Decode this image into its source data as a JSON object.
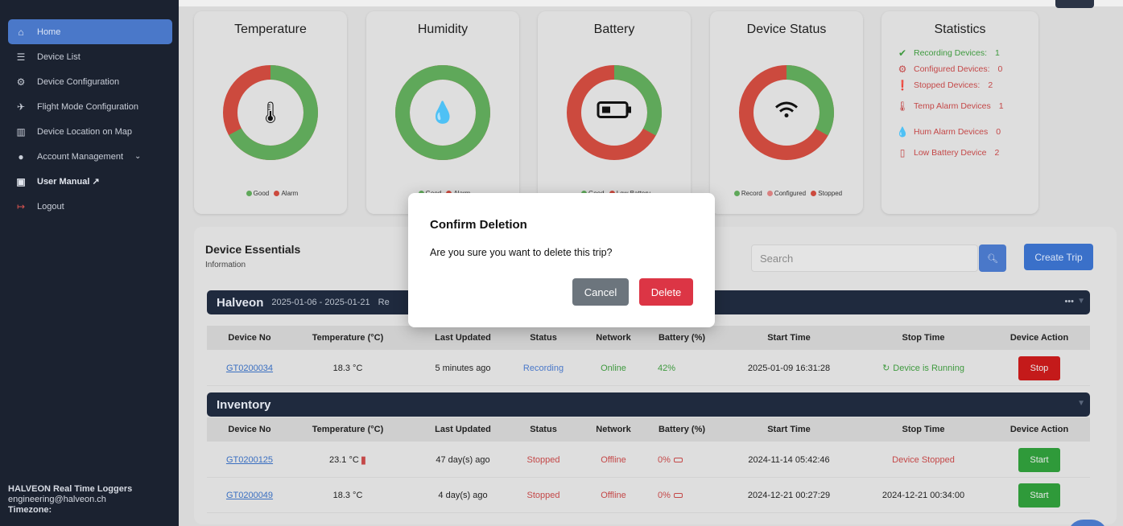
{
  "sidebar": {
    "items": [
      {
        "label": "Home",
        "icon": "home-icon"
      },
      {
        "label": "Device List",
        "icon": "list-icon"
      },
      {
        "label": "Device Configuration",
        "icon": "gear-icon"
      },
      {
        "label": "Flight Mode Configuration",
        "icon": "plane-icon"
      },
      {
        "label": "Device Location on Map",
        "icon": "map-icon"
      },
      {
        "label": "Account Management",
        "icon": "user-icon"
      },
      {
        "label": "User Manual ↗",
        "icon": "manual-icon"
      },
      {
        "label": "Logout",
        "icon": "logout-icon"
      }
    ],
    "footer": {
      "company": "HALVEON Real Time Loggers",
      "email": "engineering@halveon.ch",
      "timezone": "Timezone:"
    }
  },
  "cards": {
    "temperature": {
      "title": "Temperature",
      "legend_good": "Good",
      "legend_alarm": "Alarm",
      "good_fraction": 0.67
    },
    "humidity": {
      "title": "Humidity",
      "legend_good": "Good",
      "legend_alarm": "Alarm",
      "good_fraction": 1.0
    },
    "battery": {
      "title": "Battery",
      "legend_good": "Good",
      "legend_low": "Low Battery",
      "good_fraction": 0.33
    },
    "device_status": {
      "title": "Device Status",
      "legend_record": "Record",
      "legend_configured": "Configured",
      "legend_stopped": "Stopped",
      "record_fraction": 0.33
    },
    "statistics": {
      "title": "Statistics",
      "items": [
        {
          "label": "Recording Devices:",
          "value": "1",
          "color": "#3f9a3f"
        },
        {
          "label": "Configured Devices:",
          "value": "0",
          "color": "#c44848"
        },
        {
          "label": "Stopped Devices:",
          "value": "2",
          "color": "#c44848"
        },
        {
          "label": "Temp Alarm Devices",
          "value": "1",
          "color": "#c44848"
        },
        {
          "label": "Hum Alarm Devices",
          "value": "0",
          "color": "#c44848"
        },
        {
          "label": "Low Battery Device",
          "value": "2",
          "color": "#c44848"
        }
      ]
    }
  },
  "essentials": {
    "title": "Device Essentials",
    "subtitle": "Information",
    "search_placeholder": "Search",
    "create_label": "Create Trip",
    "headers": [
      "Device No",
      "Temperature (°C)",
      "Last Updated",
      "Status",
      "Network",
      "Battery (%)",
      "Start Time",
      "Stop Time",
      "Device Action"
    ],
    "groups": [
      {
        "name": "Halveon",
        "dates": "2025-01-06 - 2025-01-21",
        "extra": "Re",
        "menu": "•••",
        "rows": [
          {
            "device": "GT0200034",
            "temp": "18.3 °C",
            "updated": "5 minutes ago",
            "status": "Recording",
            "network": "Online",
            "battery": "42%",
            "start": "2025-01-09 16:31:28",
            "stop": "Device is Running",
            "action": "Stop"
          }
        ]
      },
      {
        "name": "Inventory",
        "rows": [
          {
            "device": "GT0200125",
            "temp": "23.1 °C",
            "updated": "47 day(s) ago",
            "status": "Stopped",
            "network": "Offline",
            "battery": "0%",
            "start": "2024-11-14 05:42:46",
            "stop": "Device Stopped",
            "action": "Start"
          },
          {
            "device": "GT0200049",
            "temp": "18.3 °C",
            "updated": "4 day(s) ago",
            "status": "Stopped",
            "network": "Offline",
            "battery": "0%",
            "start": "2024-12-21 00:27:29",
            "stop": "2024-12-21 00:34:00",
            "action": "Start"
          }
        ]
      }
    ]
  },
  "modal": {
    "title": "Confirm Deletion",
    "body": "Are you sure you want to delete this trip?",
    "cancel": "Cancel",
    "delete": "Delete"
  },
  "colors": {
    "good": "#5fa85a",
    "alarm": "#cc4a3e",
    "configured": "#d98080",
    "accent": "#4a78c9"
  }
}
